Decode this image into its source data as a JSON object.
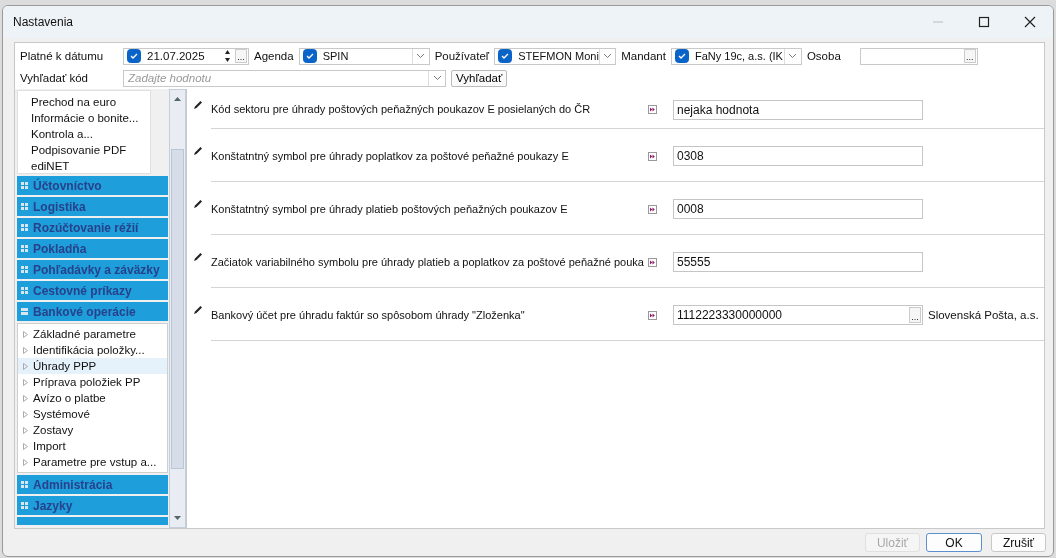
{
  "window": {
    "title": "Nastavenia"
  },
  "filter": {
    "date": {
      "label": "Platné k dátumu",
      "checked": true,
      "value": "21.07.2025",
      "button": "..."
    },
    "agenda": {
      "label": "Agenda",
      "checked": true,
      "value": "SPIN"
    },
    "user": {
      "label": "Používateľ",
      "checked": true,
      "value": "STEFMON Moni"
    },
    "mandant": {
      "label": "Mandant",
      "checked": true,
      "value": "FaNy 19c, a.s. (IK"
    },
    "person": {
      "label": "Osoba",
      "button": "..."
    },
    "code_search": {
      "label": "Vyhľadať kód",
      "placeholder": "Zadajte hodnotu",
      "button": "Vyhľadať"
    }
  },
  "sidebar": {
    "top_items": [
      "Prechod na euro",
      "Informácie o bonite...",
      "Kontrola a...",
      "Podpisovanie PDF",
      "ediNET"
    ],
    "groups": [
      {
        "label": "Účtovníctvo",
        "expanded": false
      },
      {
        "label": "Logistika",
        "expanded": false
      },
      {
        "label": "Rozúčtovanie réžií",
        "expanded": false
      },
      {
        "label": "Pokladňa",
        "expanded": false
      },
      {
        "label": "Pohľadávky a záväzky",
        "expanded": false
      },
      {
        "label": "Cestovné príkazy",
        "expanded": false
      },
      {
        "label": "Bankové operácie",
        "expanded": true,
        "children": [
          {
            "label": "Základné parametre",
            "selected": false
          },
          {
            "label": "Identifikácia položky...",
            "selected": false
          },
          {
            "label": "Úhrady PPP",
            "selected": true
          },
          {
            "label": "Príprava položiek PP",
            "selected": false
          },
          {
            "label": "Avízo o platbe",
            "selected": false
          },
          {
            "label": "Systémové",
            "selected": false
          },
          {
            "label": "Zostavy",
            "selected": false
          },
          {
            "label": "Import",
            "selected": false
          },
          {
            "label": "Parametre pre vstup a...",
            "selected": false
          }
        ]
      },
      {
        "label": "Administrácia",
        "expanded": false
      },
      {
        "label": "Jazyky",
        "expanded": false
      }
    ]
  },
  "settings": [
    {
      "label": "Kód sektoru pre úhrady poštových peňažných poukazov E posielaných do ČR",
      "value": "nejaka hodnota"
    },
    {
      "label": "Konštatntný symbol pre úhrady poplatkov za poštové peňažné poukazy E",
      "value": "0308"
    },
    {
      "label": "Konštatntný symbol pre úhrady platieb poštových peňažných poukazov E",
      "value": "0008"
    },
    {
      "label": "Začiatok variabilného symbolu pre úhrady platieb a poplatkov za poštové peňažné pouka",
      "value": "55555"
    },
    {
      "label": "Bankový účet pre úhradu faktúr so spôsobom úhrady \"Zloženka\"",
      "value": "1112223330000000",
      "button": "...",
      "note": "Slovenská Pošta, a.s."
    }
  ],
  "buttons": [
    {
      "label": "Uložiť",
      "disabled": true
    },
    {
      "label": "OK",
      "disabled": false
    },
    {
      "label": "Zrušiť",
      "disabled": false
    }
  ]
}
